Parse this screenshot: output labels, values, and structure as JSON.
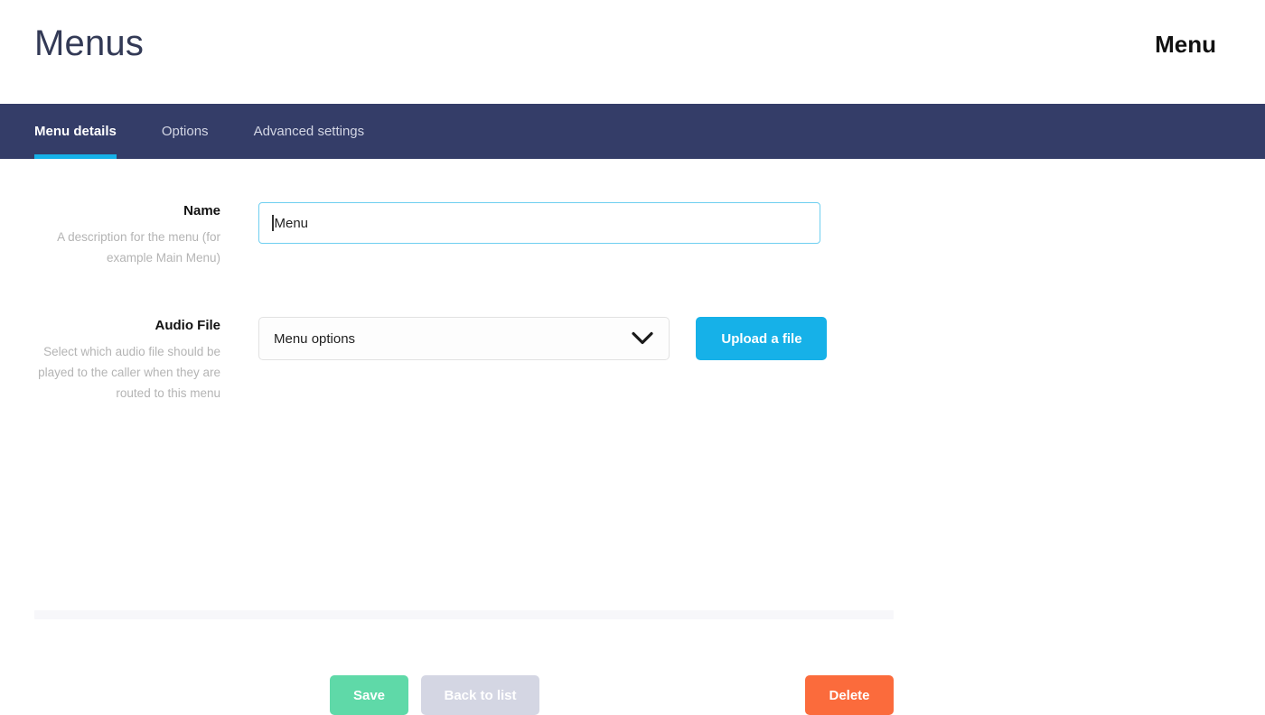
{
  "header": {
    "title": "Menus",
    "record_title": "Menu"
  },
  "tabs": [
    {
      "label": "Menu details",
      "active": true
    },
    {
      "label": "Options",
      "active": false
    },
    {
      "label": "Advanced settings",
      "active": false
    }
  ],
  "form": {
    "name_field": {
      "label": "Name",
      "help": "A description for the menu (for example Main Menu)",
      "value": "Menu",
      "placeholder": ""
    },
    "audio_field": {
      "label": "Audio File",
      "help": "Select which audio file should be played to the caller when they are routed to this menu",
      "selected_option": "Menu options",
      "options": [
        "Menu options"
      ],
      "upload_label": "Upload a file"
    }
  },
  "actions": {
    "save_label": "Save",
    "back_label": "Back to list",
    "delete_label": "Delete"
  },
  "colors": {
    "navbar": "#343d68",
    "tab_underline": "#16b1e8",
    "accent_blue": "#16b1e8",
    "save_green": "#5fd9a8",
    "back_gray": "#d4d6e3",
    "delete_orange": "#fb6b3c",
    "input_focus_border": "#6ecff0",
    "title_navy": "#333a56",
    "help_gray": "#b4b4b4"
  }
}
